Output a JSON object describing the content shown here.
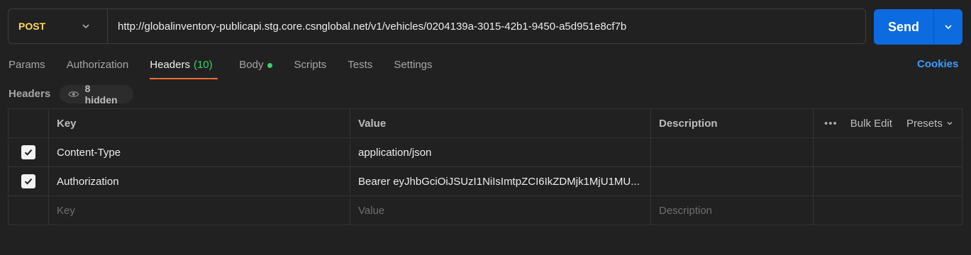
{
  "request": {
    "method": "POST",
    "url": "http://globalinventory-publicapi.stg.core.csnglobal.net/v1/vehicles/0204139a-3015-42b1-9450-a5d951e8cf7b",
    "send_label": "Send"
  },
  "tabs": [
    {
      "label": "Params"
    },
    {
      "label": "Authorization"
    },
    {
      "label": "Headers",
      "count": "(10)",
      "active": true
    },
    {
      "label": "Body",
      "indicator": "green-dot"
    },
    {
      "label": "Scripts"
    },
    {
      "label": "Tests"
    },
    {
      "label": "Settings"
    }
  ],
  "cookies_label": "Cookies",
  "headers_section": {
    "title": "Headers",
    "hidden_label": "8 hidden",
    "columns": {
      "key": "Key",
      "value": "Value",
      "description": "Description"
    },
    "actions": {
      "more": "•••",
      "bulk_edit": "Bulk Edit",
      "presets": "Presets"
    },
    "rows": [
      {
        "checked": true,
        "key": "Content-Type",
        "value": "application/json",
        "description": ""
      },
      {
        "checked": true,
        "key": "Authorization",
        "value": "Bearer eyJhbGciOiJSUzI1NiIsImtpZCI6IkZDMjk1MjU1MU...",
        "description": ""
      }
    ],
    "placeholder": {
      "key": "Key",
      "value": "Value",
      "description": "Description"
    }
  },
  "colors": {
    "method": "#ffd95a",
    "send": "#0d6be0",
    "active_tab_underline": "#ff6c37",
    "count": "#3ecf6a",
    "cookies": "#3d9bff"
  }
}
